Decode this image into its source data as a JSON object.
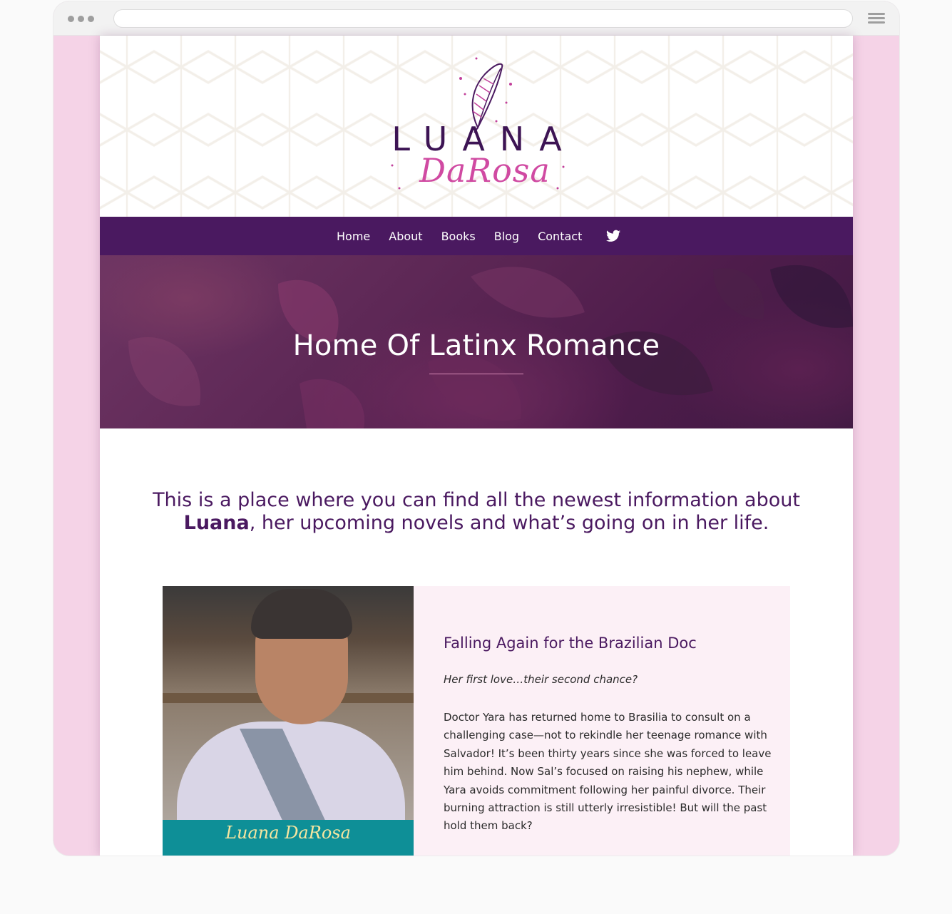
{
  "site": {
    "logo": {
      "first_name": "LUANA",
      "last_name": "DaRosa"
    },
    "nav": {
      "items": [
        "Home",
        "About",
        "Books",
        "Blog",
        "Contact"
      ],
      "social_icon": "twitter-icon"
    },
    "hero": {
      "title": "Home Of Latinx Romance"
    },
    "intro": {
      "line1": "This is a place where you can find all the newest information about",
      "line2_bold": "Luana",
      "line2_rest": ", her upcoming novels and what’s going on in her life."
    },
    "featured_book": {
      "cover_author": "Luana DaRosa",
      "title": "Falling Again for the Brazilian Doc",
      "tagline": "Her first love…their second chance?",
      "description_lines": [
        "Doctor Yara has returned home to Brasilia to consult on a",
        "challenging case—not to rekindle her teenage romance with",
        "Salvador! It’s been thirty years since she was forced to leave",
        "him behind. Now Sal’s focused on raising his nephew, while",
        "Yara avoids commitment following her painful divorce. Their",
        "burning attraction is still utterly irresistible! But will the past",
        "hold them back?"
      ]
    }
  },
  "colors": {
    "brand_purple": "#4a1960",
    "brand_pink": "#d04aa2",
    "frame_pink": "#f5d3e7",
    "panel_pink": "#fcf0f6",
    "cover_teal": "#0e8f97"
  }
}
